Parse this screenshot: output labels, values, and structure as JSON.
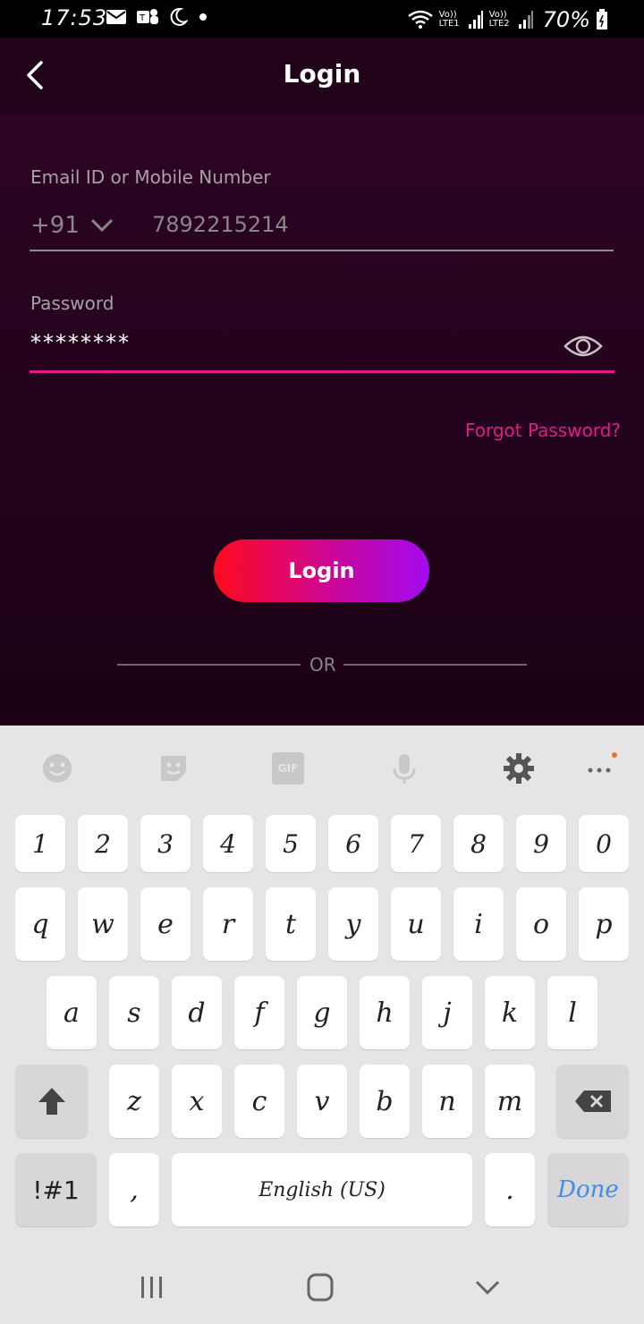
{
  "status_bar": {
    "time": "17:53",
    "battery": "70%",
    "sim1": "Vo)) LTE1",
    "sim2": "Vo)) LTE2"
  },
  "header": {
    "title": "Login",
    "back_icon": "chevron-left-icon"
  },
  "form": {
    "email_label": "Email ID or Mobile Number",
    "country_code": "+91",
    "phone_value": "7892215214",
    "password_label": "Password",
    "password_value": "********",
    "forgot_label": "Forgot Password?",
    "login_label": "Login",
    "or_label": "OR"
  },
  "keyboard": {
    "toolbar": [
      "emoji-icon",
      "sticker-icon",
      "gif-icon",
      "microphone-icon",
      "gear-icon",
      "more-icon"
    ],
    "gif_label": "GIF",
    "row_numbers": [
      "1",
      "2",
      "3",
      "4",
      "5",
      "6",
      "7",
      "8",
      "9",
      "0"
    ],
    "row1": [
      "q",
      "w",
      "e",
      "r",
      "t",
      "y",
      "u",
      "i",
      "o",
      "p"
    ],
    "row2": [
      "a",
      "s",
      "d",
      "f",
      "g",
      "h",
      "j",
      "k",
      "l"
    ],
    "row3": [
      "z",
      "x",
      "c",
      "v",
      "b",
      "n",
      "m"
    ],
    "symbols_label": "!#1",
    "comma_label": ",",
    "space_label": "English (US)",
    "period_label": ".",
    "done_label": "Done"
  },
  "colors": {
    "accent": "#e5198f",
    "header_bg": "#22041a",
    "done_blue": "#3e8ee6"
  }
}
